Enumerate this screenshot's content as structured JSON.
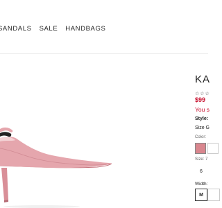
{
  "nav": {
    "items": [
      "SANDALS",
      "SALE",
      "HANDBAGS"
    ]
  },
  "product": {
    "title": "KA",
    "stars": "☆☆☆",
    "price": "$99",
    "savings": "You s",
    "style_label": "Style:",
    "style_value": "",
    "size_guide": "Size G",
    "color_label": "Color: ",
    "size_label": "Size: 7",
    "size_option": "6",
    "width_label": "Width:",
    "width_option": "M"
  },
  "colors": {
    "accent_price": "#c8102e",
    "swatch_pink": "#d9868e"
  }
}
